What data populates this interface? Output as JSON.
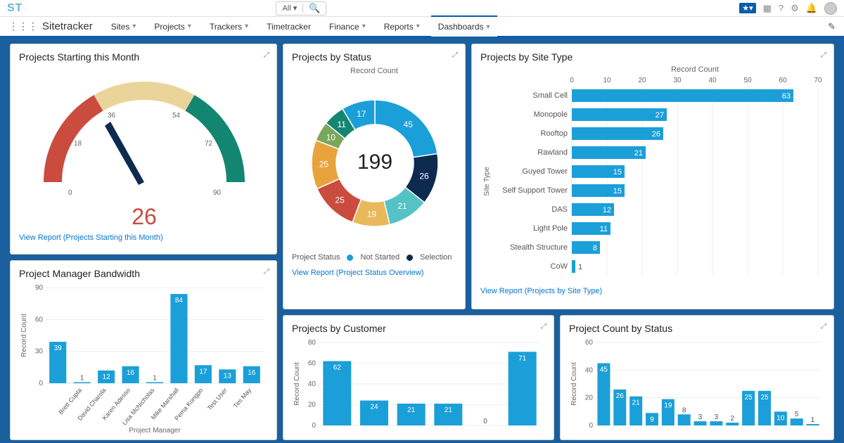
{
  "topbar": {
    "logo": "ST",
    "search_all": "All ▾"
  },
  "nav": {
    "app": "Sitetracker",
    "items": [
      "Sites",
      "Projects",
      "Trackers",
      "Timetracker",
      "Finance",
      "Reports",
      "Dashboards"
    ],
    "active": "Dashboards"
  },
  "gauge": {
    "title": "Projects Starting this Month",
    "value": 26,
    "ticks": [
      0,
      18,
      36,
      54,
      72,
      90
    ],
    "link": "View Report (Projects Starting this Month)"
  },
  "status": {
    "title": "Projects by Status",
    "sub": "Record Count",
    "total": 199,
    "legend_title": "Project Status",
    "legend": [
      "Not Started",
      "Selection"
    ],
    "link": "View Report (Project Status Overview)"
  },
  "site_type": {
    "title": "Projects by Site Type",
    "sub": "Record Count",
    "y_axis": "Site Type",
    "link": "View Report (Projects by Site Type)"
  },
  "bandwidth": {
    "title": "Project Manager Bandwidth",
    "y_axis": "Record Count",
    "x_axis": "Project Manager"
  },
  "customer": {
    "title": "Projects by Customer",
    "y_axis": "Record Count"
  },
  "count_status": {
    "title": "Project Count by Status",
    "y_axis": "Record Count"
  },
  "chart_data": [
    {
      "id": "gauge",
      "type": "gauge",
      "title": "Projects Starting this Month",
      "min": 0,
      "max": 90,
      "value": 26,
      "bands": [
        {
          "from": 0,
          "to": 30,
          "color": "#c94c3f"
        },
        {
          "from": 30,
          "to": 60,
          "color": "#ebd49a"
        },
        {
          "from": 60,
          "to": 90,
          "color": "#138672"
        }
      ],
      "ticks": [
        0,
        18,
        36,
        54,
        72,
        90
      ]
    },
    {
      "id": "projects_by_status",
      "type": "donut",
      "title": "Projects by Status",
      "total": 199,
      "series": [
        {
          "name": "Not Started",
          "value": 45,
          "color": "#1b9fd8"
        },
        {
          "name": "Selection",
          "value": 26,
          "color": "#0d2a4f"
        },
        {
          "name": "",
          "value": 21,
          "color": "#55c2c6"
        },
        {
          "name": "",
          "value": 19,
          "color": "#e8b85b"
        },
        {
          "name": "",
          "value": 25,
          "color": "#c94c3f"
        },
        {
          "name": "",
          "value": 25,
          "color": "#e8a33d"
        },
        {
          "name": "",
          "value": 10,
          "color": "#7aa85a"
        },
        {
          "name": "",
          "value": 11,
          "color": "#138672"
        },
        {
          "name": "",
          "value": 17,
          "color": "#1b9fd8"
        }
      ]
    },
    {
      "id": "projects_by_site_type",
      "type": "bar",
      "orientation": "horizontal",
      "title": "Projects by Site Type",
      "xlabel": "Record Count",
      "ylabel": "Site Type",
      "xlim": [
        0,
        70
      ],
      "categories": [
        "Small Cell",
        "Monopole",
        "Rooftop",
        "Rawland",
        "Guyed Tower",
        "Self Support Tower",
        "DAS",
        "Light Pole",
        "Stealth Structure",
        "CoW"
      ],
      "values": [
        63,
        27,
        26,
        21,
        15,
        15,
        12,
        11,
        8,
        1
      ]
    },
    {
      "id": "pm_bandwidth",
      "type": "bar",
      "title": "Project Manager Bandwidth",
      "xlabel": "Project Manager",
      "ylabel": "Record Count",
      "ylim": [
        0,
        90
      ],
      "categories": [
        "",
        "Brett Cupta",
        "David Charola",
        "Karen Adesso",
        "Lisa McNicholas",
        "Mike Marshall",
        "Pema Kongpo",
        "Test User",
        "Tim May"
      ],
      "values": [
        39,
        1,
        12,
        16,
        1,
        84,
        17,
        13,
        16
      ]
    },
    {
      "id": "projects_by_customer",
      "type": "bar",
      "title": "Projects by Customer",
      "ylabel": "Record Count",
      "ylim": [
        0,
        80
      ],
      "categories": [
        "",
        "",
        "",
        "",
        "",
        ""
      ],
      "values": [
        62,
        24,
        21,
        21,
        0,
        71
      ]
    },
    {
      "id": "project_count_by_status",
      "type": "bar",
      "title": "Project Count by Status",
      "ylabel": "Record Count",
      "ylim": [
        0,
        60
      ],
      "categories": [
        "",
        "",
        "",
        "",
        "",
        "",
        "",
        "",
        "",
        "",
        "",
        "",
        "",
        ""
      ],
      "values": [
        45,
        26,
        21,
        9,
        19,
        8,
        3,
        3,
        2,
        25,
        25,
        10,
        5,
        1
      ]
    }
  ]
}
